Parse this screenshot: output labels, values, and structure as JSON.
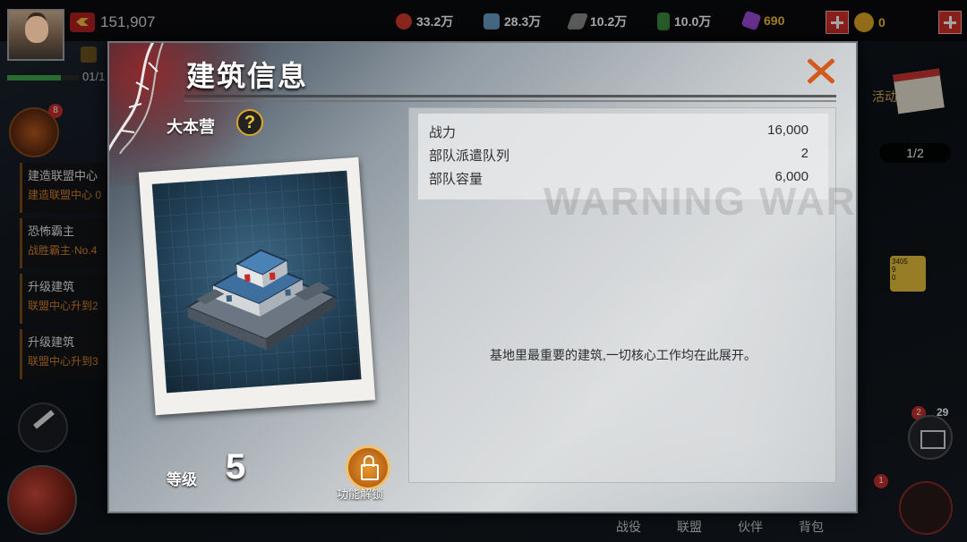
{
  "topbar": {
    "power_value": "151,907",
    "resources": [
      {
        "name": "apple-icon",
        "value": "33.2万",
        "color": "#d33a2c"
      },
      {
        "name": "water-icon",
        "value": "28.3万",
        "color": "#6aa0c8"
      },
      {
        "name": "steel-icon",
        "value": "10.2万",
        "color": "#8b8b8b"
      },
      {
        "name": "fuel-icon",
        "value": "10.0万",
        "color": "#3d8a3d"
      },
      {
        "name": "crystal-icon",
        "value": "690",
        "color": "#9a4ad8"
      }
    ],
    "coins": "0"
  },
  "left_panel": {
    "xp_text": "01/1",
    "quest_badge": "8",
    "tasks": [
      {
        "title": "建造联盟中心",
        "sub": "建造联盟中心 0"
      },
      {
        "title": "恐怖霸主",
        "sub": "战胜霸主·No.4"
      },
      {
        "title": "升级建筑",
        "sub": "联盟中心升到2"
      },
      {
        "title": "升级建筑",
        "sub": "联盟中心升到3"
      }
    ]
  },
  "right_panel": {
    "activity_label": "活动",
    "page_indicator": "1/2",
    "warn_values": [
      "3405",
      "9",
      "0"
    ],
    "badge_a": "2",
    "mail_badge": "29",
    "badge_b": "1"
  },
  "bottom_nav": [
    "战役",
    "联盟",
    "伙伴",
    "背包"
  ],
  "modal": {
    "title": "建筑信息",
    "building_name": "大本营",
    "help_label": "?",
    "level_label": "等级",
    "level_value": "5",
    "unlock_label": "功能解锁",
    "stats": [
      {
        "label": "战力",
        "value": "16,000"
      },
      {
        "label": "部队派遣队列",
        "value": "2"
      },
      {
        "label": "部队容量",
        "value": "6,000"
      }
    ],
    "description": "基地里最重要的建筑,一切核心工作均在此展开。",
    "watermark": "WARNING WARNING"
  }
}
